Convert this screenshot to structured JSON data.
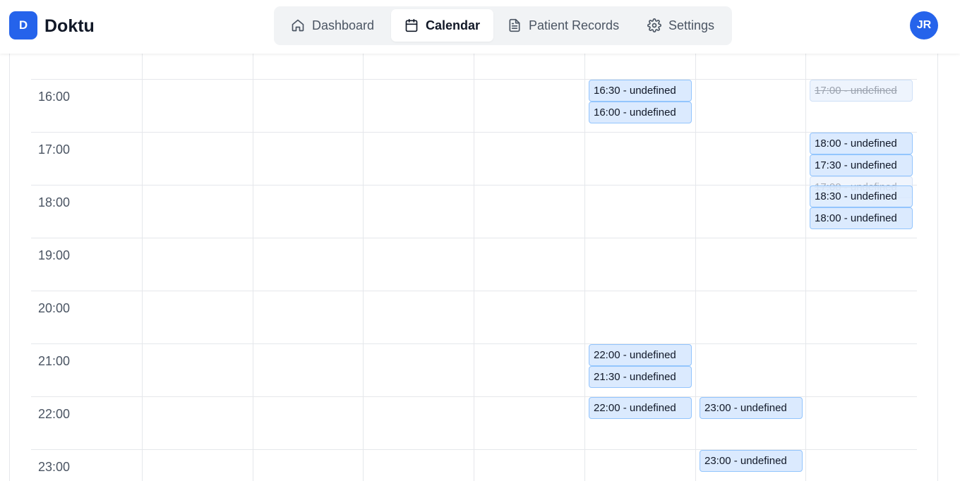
{
  "app": {
    "logo_letter": "D",
    "name": "Doktu"
  },
  "nav": [
    {
      "label": "Dashboard",
      "icon": "home-icon"
    },
    {
      "label": "Calendar",
      "icon": "calendar-icon",
      "active": true
    },
    {
      "label": "Patient Records",
      "icon": "document-icon"
    },
    {
      "label": "Settings",
      "icon": "gear-icon"
    }
  ],
  "user": {
    "initials": "JR"
  },
  "colors": {
    "accent": "#2563eb",
    "event_bg": "#dbeafe",
    "event_border": "#93c5fd"
  },
  "time_slots": [
    "16:00",
    "17:00",
    "18:00",
    "19:00",
    "20:00",
    "21:00",
    "22:00",
    "23:00"
  ],
  "events": [
    {
      "label": "16:30 - undefined",
      "day": 5,
      "status": "active"
    },
    {
      "label": "16:00 - undefined",
      "day": 5,
      "status": "active"
    },
    {
      "label": "17:00 - undefined",
      "day": 7,
      "status": "cancelled"
    },
    {
      "label": "18:00 - undefined",
      "day": 7,
      "status": "active"
    },
    {
      "label": "17:30 - undefined",
      "day": 7,
      "status": "active"
    },
    {
      "label": "17:00 - undefined",
      "day": 7,
      "status": "cancelled"
    },
    {
      "label": "18:30 - undefined",
      "day": 7,
      "status": "active"
    },
    {
      "label": "18:00 - undefined",
      "day": 7,
      "status": "active"
    },
    {
      "label": "22:00 - undefined",
      "day": 5,
      "status": "active"
    },
    {
      "label": "21:30 - undefined",
      "day": 5,
      "status": "active"
    },
    {
      "label": "22:00 - undefined",
      "day": 5,
      "status": "active"
    },
    {
      "label": "23:00 - undefined",
      "day": 6,
      "status": "active"
    },
    {
      "label": "23:00 - undefined",
      "day": 6,
      "status": "active"
    }
  ]
}
